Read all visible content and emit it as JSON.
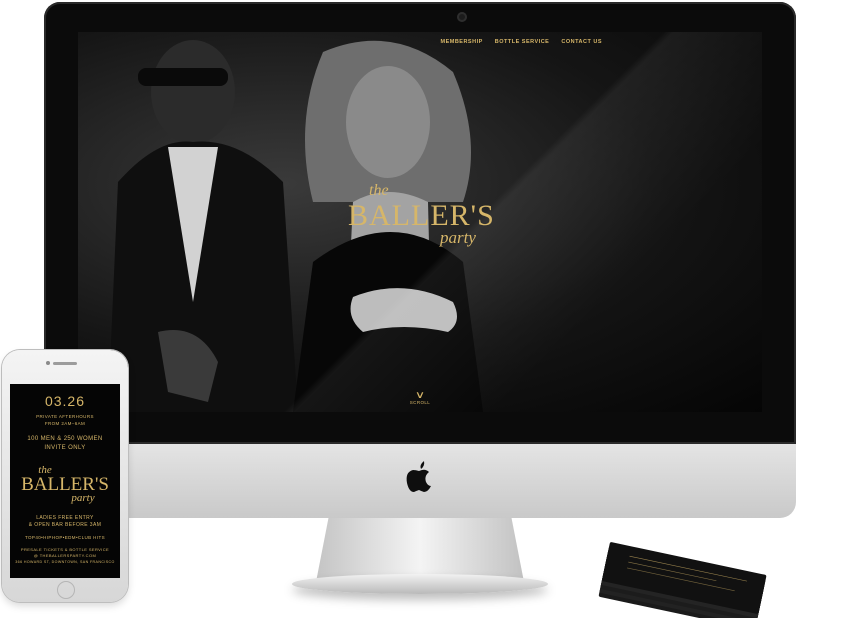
{
  "website": {
    "nav": [
      "MEMBERSHIP",
      "BOTTLE SERVICE",
      "CONTACT US"
    ],
    "logo": {
      "the": "the",
      "main": "BALLER'S",
      "party": "party"
    },
    "scroll_label": "SCROLL"
  },
  "phone_flyer": {
    "date": "03.26",
    "line1": "PRIVATE AFTERHOURS",
    "line2": "FROM 2AM–6AM",
    "line3": "100 MEN & 250 WOMEN",
    "line4": "INVITE ONLY",
    "logo": {
      "the": "the",
      "main": "BALLER'S",
      "party": "party"
    },
    "line5": "LADIES FREE ENTRY",
    "line6": "& OPEN BAR BEFORE 3AM",
    "line7": "TOP40•HIPHOP•EDM•CLUB HITS",
    "line8": "PRESALE TICKETS & BOTTLE SERVICE",
    "line9": "@ THEBALLERSPARTY.COM",
    "line10": "366 HOWARD ST, DOWNTOWN, SAN FRANCISCO"
  },
  "colors": {
    "gold": "#d6b669",
    "screen_bg": "#050505"
  }
}
